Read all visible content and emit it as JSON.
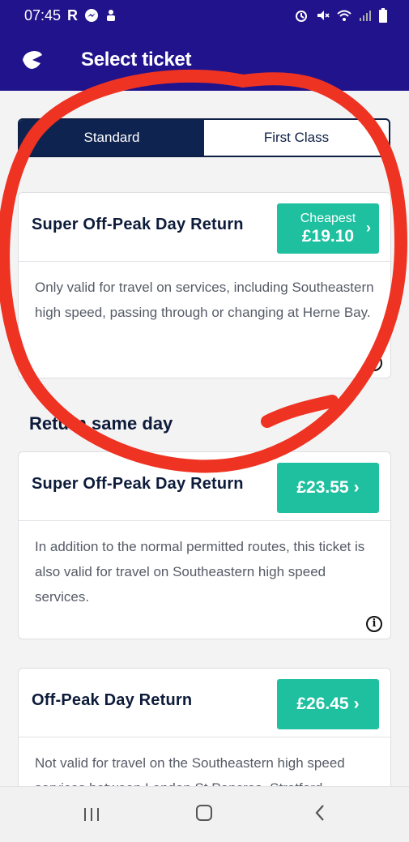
{
  "status_bar": {
    "time": "07:45",
    "icons": [
      "r-icon",
      "messenger-icon",
      "notification-icon",
      "alarm-icon",
      "mute-icon",
      "wifi-icon",
      "signal-icon",
      "battery-icon"
    ]
  },
  "app_bar": {
    "title": "Select ticket",
    "logo_icon": "app-logo-icon"
  },
  "class_tabs": [
    "Standard",
    "First Class"
  ],
  "cheapest_card": {
    "name": "Super Off-Peak Day Return",
    "badge": "Cheapest",
    "price": "£19.10",
    "description": "Only valid for travel on services, including Southeastern high speed, passing through or changing at Herne Bay."
  },
  "section_title": "Return same day",
  "tickets": [
    {
      "name": "Super Off-Peak Day Return",
      "price": "£23.55",
      "description": "In addition to the normal permitted routes, this ticket is also valid for travel on Southeastern high speed services."
    },
    {
      "name": "Off-Peak Day Return",
      "price": "£26.45",
      "description": "Not valid for travel on the Southeastern high speed services between London St Pancras, Stratford"
    }
  ],
  "colors": {
    "header_bg": "#21138b",
    "tab_active_bg": "#0e2350",
    "price_button": "#1ec0a0",
    "annotation_circle": "#ee3322"
  }
}
